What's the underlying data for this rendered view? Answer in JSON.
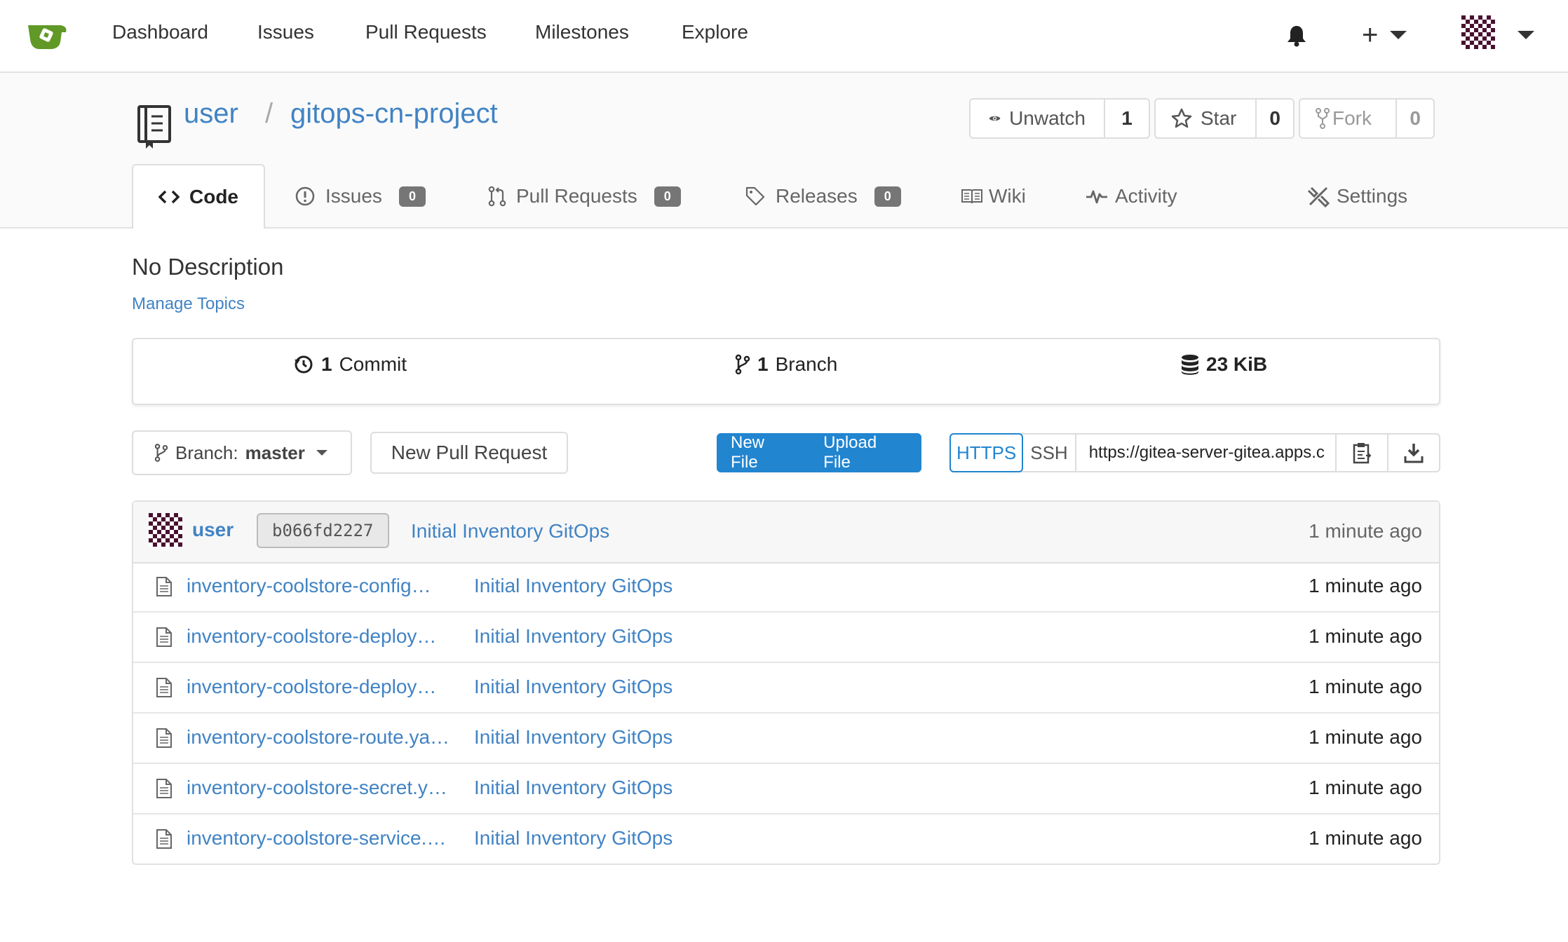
{
  "nav": {
    "items": [
      "Dashboard",
      "Issues",
      "Pull Requests",
      "Milestones",
      "Explore"
    ],
    "brand_color": "#609926"
  },
  "repo": {
    "owner": "user",
    "separator": "/",
    "name": "gitops-cn-project",
    "watch": {
      "label": "Unwatch",
      "count": "1"
    },
    "star": {
      "label": "Star",
      "count": "0"
    },
    "fork": {
      "label": "Fork",
      "count": "0"
    }
  },
  "tabs": {
    "code": {
      "label": "Code"
    },
    "issues": {
      "label": "Issues",
      "count": "0"
    },
    "pulls": {
      "label": "Pull Requests",
      "count": "0"
    },
    "releases": {
      "label": "Releases",
      "count": "0"
    },
    "wiki": {
      "label": "Wiki"
    },
    "activity": {
      "label": "Activity"
    },
    "settings": {
      "label": "Settings"
    }
  },
  "description": "No Description",
  "manage_topics": "Manage Topics",
  "stats": {
    "commits_num": "1",
    "commits_label": "Commit",
    "branches_num": "1",
    "branches_label": "Branch",
    "size": "23 KiB"
  },
  "toolbar": {
    "branch_prefix": "Branch:",
    "branch_name": "master",
    "new_pr": "New Pull Request",
    "new_file": "New File",
    "upload_file": "Upload File",
    "https": "HTTPS",
    "ssh": "SSH",
    "clone_url": "https://gitea-server-gitea.apps.c"
  },
  "last_commit": {
    "user": "user",
    "sha": "b066fd2227",
    "message": "Initial Inventory GitOps",
    "time": "1 minute ago"
  },
  "files": [
    {
      "name": "inventory-coolstore-config…",
      "message": "Initial Inventory GitOps",
      "time": "1 minute ago"
    },
    {
      "name": "inventory-coolstore-deploy…",
      "message": "Initial Inventory GitOps",
      "time": "1 minute ago"
    },
    {
      "name": "inventory-coolstore-deploy…",
      "message": "Initial Inventory GitOps",
      "time": "1 minute ago"
    },
    {
      "name": "inventory-coolstore-route.ya…",
      "message": "Initial Inventory GitOps",
      "time": "1 minute ago"
    },
    {
      "name": "inventory-coolstore-secret.y…",
      "message": "Initial Inventory GitOps",
      "time": "1 minute ago"
    },
    {
      "name": "inventory-coolstore-service.…",
      "message": "Initial Inventory GitOps",
      "time": "1 minute ago"
    }
  ]
}
